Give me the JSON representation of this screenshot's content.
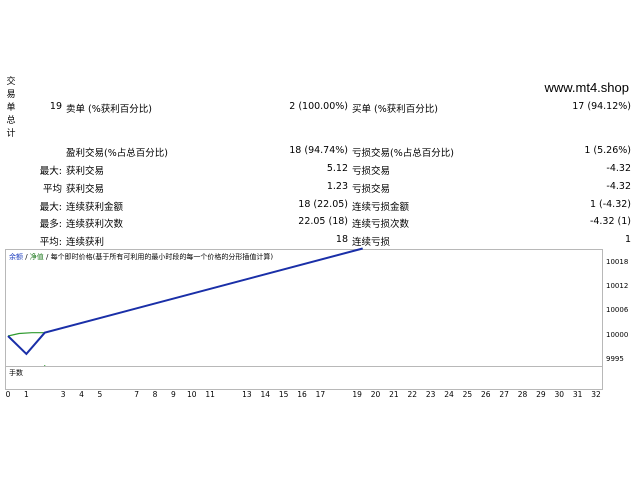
{
  "vertical_label": [
    "交",
    "易",
    "单",
    "总",
    "计"
  ],
  "site": "www.mt4.shop",
  "row1": {
    "count": "19",
    "label": "卖单 (%获利百分比)",
    "value": "2 (100.00%)",
    "label2": "买单 (%获利百分比)",
    "value2": "17 (94.12%)"
  },
  "row2": {
    "label": "盈利交易(%占总百分比)",
    "value": "18 (94.74%)",
    "label2": "亏损交易(%占总百分比)",
    "value2": "1 (5.26%)"
  },
  "rows": [
    {
      "prefix": "最大:",
      "label": "获利交易",
      "value": "5.12",
      "label2": "亏损交易",
      "value2": "-4.32"
    },
    {
      "prefix": "平均",
      "label": "获利交易",
      "value": "1.23",
      "label2": "亏损交易",
      "value2": "-4.32"
    },
    {
      "prefix": "最大:",
      "label": "连续获利金额",
      "value": "18 (22.05)",
      "label2": "连续亏损金额",
      "value2": "1 (-4.32)"
    },
    {
      "prefix": "最多:",
      "label": "连续获利次数",
      "value": "22.05 (18)",
      "label2": "连续亏损次数",
      "value2": "-4.32 (1)"
    },
    {
      "prefix": "平均:",
      "label": "连续获利",
      "value": "18",
      "label2": "连续亏损",
      "value2": "1"
    }
  ],
  "chart_legend": {
    "balance": "余额",
    "sep1": " / ",
    "equity": "净值",
    "note": " / 每个即时价格(基于所有可利用的最小时段的每一个价格的分形插值计算)"
  },
  "volume_label": "手数",
  "colors": {
    "balance": "#1a2fa8",
    "equity": "#2f9a2f",
    "volume": "#2f9a2f"
  },
  "chart_data": {
    "type": "line",
    "y_ticks": [
      "10018",
      "10012",
      "10006",
      "10000",
      "9995"
    ],
    "y_tick_values": [
      10018,
      10012,
      10006,
      10000,
      9995
    ],
    "ylim": [
      9995,
      10021
    ],
    "x_ticks": [
      "0",
      "1",
      "3",
      "4",
      "5",
      "7",
      "8",
      "9",
      "10",
      "11",
      "13",
      "14",
      "15",
      "16",
      "17",
      "19",
      "20",
      "21",
      "22",
      "23",
      "24",
      "25",
      "26",
      "27",
      "28",
      "29",
      "30",
      "31",
      "32"
    ],
    "xlim": [
      0,
      32
    ],
    "series": [
      {
        "name": "余额",
        "x": [
          0,
          1,
          2,
          19.3
        ],
        "y": [
          10000,
          9995.7,
          10000.8,
          10021
        ]
      },
      {
        "name": "净值",
        "x": [
          0,
          0.6,
          1.3,
          2,
          19.3
        ],
        "y": [
          10000,
          10000.6,
          10000.8,
          10000.8,
          10021
        ]
      }
    ],
    "volume": {
      "x": [
        1,
        2,
        3,
        4,
        5,
        6,
        7,
        8,
        9,
        10,
        11,
        12,
        13,
        14,
        15,
        16,
        17,
        18,
        19
      ],
      "y": [
        0.5,
        1,
        0.5,
        0.5,
        0.5,
        0.5,
        0.5,
        0.5,
        0.5,
        0.5,
        0.5,
        0.5,
        0.5,
        0.5,
        0.5,
        0.5,
        0.5,
        0.5,
        0.5
      ]
    }
  }
}
